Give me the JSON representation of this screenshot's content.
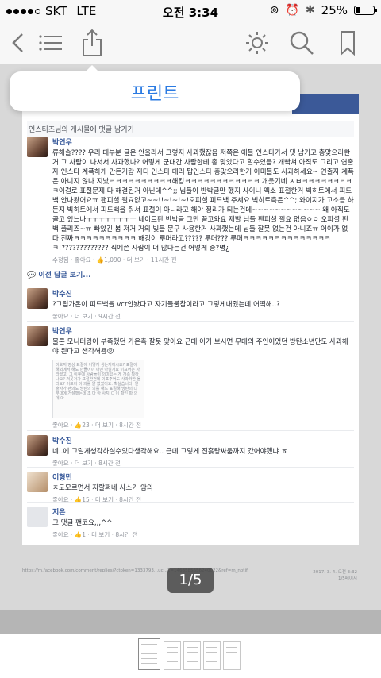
{
  "status": {
    "carrier": "SKT",
    "network": "LTE",
    "time": "오전 3:34",
    "battery": "25%"
  },
  "toolbar": {
    "icons": [
      "back-icon",
      "list-icon",
      "share-icon",
      "brightness-icon",
      "search-icon",
      "bookmark-icon"
    ]
  },
  "popup": {
    "label": "프린트"
  },
  "page": {
    "section_title": "인스티즈님의 게시물에 댓글 남기기",
    "comments": [
      {
        "author": "박연우",
        "text": "류해솔???? 우리 대부분 글은 안올라서 그렇지 사과했잖음 저쪽은 애들 인스타가서 댓 남기고 총맞으라한거 그 사람이 나서서 사과했나? 어떻게 군대간 사람한테 총 맞았다고 할수있음? 개빡쳐 아직도 그리고 연출자 인스타 계폭하게 만든거랑 지디 인스타 테러 탑인스타 총맞으라한거 아미들도 사과하세요~ 연출자 계폭은 아니지 않나 지났ㅋㅋㅋㅋㅋㅋㅋㅋㅋㅋ해킹ㅋㅋㅋㅋㅋㅋㅋㅋㅋㅋㅋㅋ 개웃기네 ㅅㅂㅋㅋㅋㅋㅋㅋㅋㅋㅋ이걸로 표절문제 다 해결된거 아닌데^^;; 님들이 반박글만 했지 사이니 엑소 표절한거 빅히트에서 피드백 안나왔어요ㅠ 팬피셜 필요없고~~!!~!~!~!오피셜 피드백 주세요 빅히트측은^^; 와이지가 고소를 하든지 빅히트에서 피드백을 줘서 표절이 아니라고 해야 정리가 되는건데~~~~~~~~~~~~ 왜 아직도 골고 있느나ㅜㅜㅜㅜㅜㅜㅜㅜ 네이트판 반박글 그만 끌고와요 제발 님들 팬피셜 필요 없음ㅇㅇ 오피셜 핀백 플리즈~ㅠ 빠았긴 봄 저거 거의 빛들 문구 사용한거 사과했는데 님들 잘못 없는건 아니죠ㅠ 어이가 없다 진짜ㅋㅋㅋㅋㅋㅋㅋㅋㅋㅋ 해킹이 루머라고????? 루머??? 루머ㅋㅋㅋㅋㅋㅋㅋㅋㅋㅋㅋㅋㅋㅋㅋ!????????????? 직예쓴 사람이 더 많다는건 어떻게 증?명¿",
        "actions": "수정됨 · 좋아요 · ",
        "likes": "1,090",
        "more": " · 더 보기 · 11시간 전"
      },
      {
        "author": "박수진",
        "text": "?그럼가온이 피드백을 vcr안봤다고 자기들불참이라고 그렇게내줬는데 어떡해..?",
        "actions": "좋아요 · 더 보기 · 9시간 전"
      },
      {
        "author": "박연우",
        "text": "물론 모니터링이 부족했던 가온측 잘못 맞아요 근데 이거 보시면 무대의 주인이었던 방탄소년단도 사과해야 된다고 생각해용😠",
        "embed": "이호지 영상 표절에 어떻게 생는지아시죠? 표절이 해외에서 해도 만들어이 어떤 아실거요 이표어는 사라졌고, 그 이후에 사람들이 의미있는 게 개속 확하나요? 저곳거가 표절한건데 이표주어도 사과하한 올라요? 이표지 이 의를 알 없었어요. 확실습니다. 연출자가 팬의도 방탄의 의를 해도 표절해 방탄의 다 무대에 거절했는데 조 다 아 사지 ㄷ 이 확인 파 의 데 아",
        "actions": "좋아요 · ",
        "likes": "23",
        "more": " · 더 보기 · 8시간 전"
      },
      {
        "author": "박수진",
        "text": "네..에 그럴게생각하실수있다생각해요.. 근데 그렇게 진흙탕싸움까지 갔어야했냐 ㅎ",
        "actions": "좋아요 · 더 보기 · 8시간 전"
      },
      {
        "author": "이형민",
        "text": "ㅈ도모르면서 지랄쩌네 사스가 암의",
        "actions": "좋아요 · ",
        "likes": "15",
        "more": " · 더 보기 · 8시간 전"
      },
      {
        "author": "지은",
        "text": "그 댓글 팬코요,,,^^",
        "actions": "좋아요 · ",
        "likes": "1",
        "more": " · 더 보기 · 8시간 전"
      }
    ],
    "more_replies": "이전 답글 보기...",
    "footer_url": "https://m.facebook.com/comment/replies/?ctoken=1333793...uc...1=1468585656240022&ref=m_notif",
    "footer_date": "2017. 3. 4. 오전 3:32",
    "footer_page": "1/5페이지"
  },
  "page_indicator": "1/5",
  "colors": {
    "accent": "#2a7ae2",
    "facebook": "#3b5998",
    "link": "#365899"
  }
}
